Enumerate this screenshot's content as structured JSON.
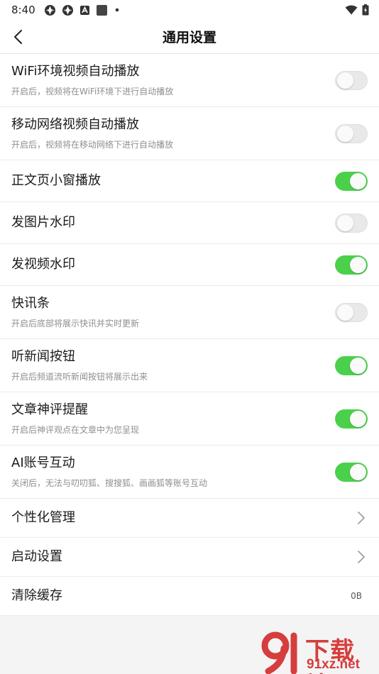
{
  "status_bar": {
    "time": "8:40"
  },
  "header": {
    "title": "通用设置"
  },
  "settings": [
    {
      "label": "WiFi环境视频自动播放",
      "desc": "开启后，视频将在WiFi环境下进行自动播放",
      "state": "off"
    },
    {
      "label": "移动网络视频自动播放",
      "desc": "开启后，视频将在移动网络下进行自动播放",
      "state": "off"
    },
    {
      "label": "正文页小窗播放",
      "state": "on"
    },
    {
      "label": "发图片水印",
      "state": "off"
    },
    {
      "label": "发视频水印",
      "state": "on"
    },
    {
      "label": "快讯条",
      "desc": "开启后底部将展示快讯并实时更新",
      "state": "off"
    },
    {
      "label": "听新闻按钮",
      "desc": "开启后频道流听新闻按钮将展示出来",
      "state": "on"
    },
    {
      "label": "文章神评提醒",
      "desc": "开启后神评观点在文章中为您呈现",
      "state": "on"
    },
    {
      "label": "AI账号互动",
      "desc": "关闭后，无法与叨叨狐、搜搜狐、画画狐等账号互动",
      "state": "on"
    }
  ],
  "nav_items": [
    {
      "label": "个性化管理"
    },
    {
      "label": "启动设置"
    }
  ],
  "cache": {
    "label": "清除缓存",
    "value": "0B"
  },
  "watermark": {
    "brand": "下载站",
    "site": "91xz.net"
  },
  "colors": {
    "toggle_on": "#4bd04b",
    "toggle_off": "#e9e9e9",
    "watermark": "#d63d3d"
  }
}
